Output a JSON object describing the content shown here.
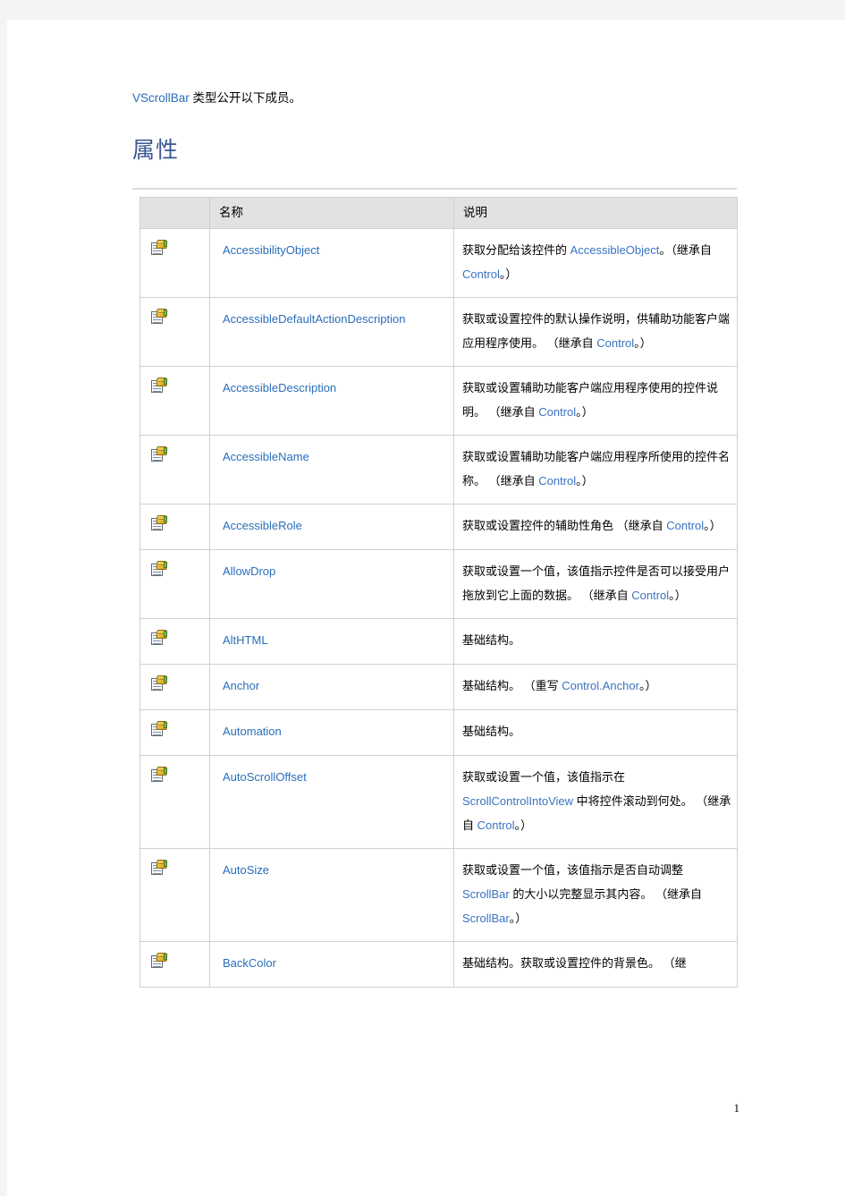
{
  "document": {
    "intro_prefix_link": "VScrollBar",
    "intro_text": " 类型公开以下成员。",
    "section_heading": "属性",
    "page_number": "1"
  },
  "table": {
    "headers": {
      "icon": "",
      "name": "名称",
      "description": "说明"
    },
    "icon_name": "public-property-icon",
    "rows": [
      {
        "name": "AccessibilityObject",
        "desc_parts": [
          {
            "t": "获取分配给该控件的 ",
            "link": false
          },
          {
            "t": "AccessibleObject",
            "link": true
          },
          {
            "t": "。（继承自 ",
            "link": false
          },
          {
            "t": "Control",
            "link": true
          },
          {
            "t": "。）",
            "link": false
          }
        ]
      },
      {
        "name": "AccessibleDefaultActionDescription",
        "desc_parts": [
          {
            "t": "获取或设置控件的默认操作说明，供辅助功能客户端应用程序使用。 （继承自 ",
            "link": false
          },
          {
            "t": "Control",
            "link": true
          },
          {
            "t": "。）",
            "link": false
          }
        ]
      },
      {
        "name": "AccessibleDescription",
        "desc_parts": [
          {
            "t": "获取或设置辅助功能客户端应用程序使用的控件说明。 （继承自 ",
            "link": false
          },
          {
            "t": "Control",
            "link": true
          },
          {
            "t": "。）",
            "link": false
          }
        ]
      },
      {
        "name": "AccessibleName",
        "desc_parts": [
          {
            "t": "获取或设置辅助功能客户端应用程序所使用的控件名称。 （继承自 ",
            "link": false
          },
          {
            "t": "Control",
            "link": true
          },
          {
            "t": "。）",
            "link": false
          }
        ]
      },
      {
        "name": "AccessibleRole",
        "desc_parts": [
          {
            "t": "获取或设置控件的辅助性角色 （继承自 ",
            "link": false
          },
          {
            "t": "Control",
            "link": true
          },
          {
            "t": "。）",
            "link": false
          }
        ]
      },
      {
        "name": "AllowDrop",
        "desc_parts": [
          {
            "t": "获取或设置一个值，该值指示控件是否可以接受用户拖放到它上面的数据。 （继承自 ",
            "link": false
          },
          {
            "t": "Control",
            "link": true
          },
          {
            "t": "。）",
            "link": false
          }
        ]
      },
      {
        "name": "AltHTML",
        "desc_parts": [
          {
            "t": "基础结构。",
            "link": false
          }
        ]
      },
      {
        "name": "Anchor",
        "desc_parts": [
          {
            "t": "基础结构。 （重写 ",
            "link": false
          },
          {
            "t": "Control.Anchor",
            "link": true
          },
          {
            "t": "。）",
            "link": false
          }
        ]
      },
      {
        "name": "Automation",
        "desc_parts": [
          {
            "t": "基础结构。",
            "link": false
          }
        ]
      },
      {
        "name": "AutoScrollOffset",
        "desc_parts": [
          {
            "t": "获取或设置一个值，该值指示在 ",
            "link": false
          },
          {
            "t": "ScrollControlIntoView",
            "link": true
          },
          {
            "t": " 中将控件滚动到何处。 （继承自 ",
            "link": false
          },
          {
            "t": "Control",
            "link": true
          },
          {
            "t": "。）",
            "link": false
          }
        ]
      },
      {
        "name": "AutoSize",
        "desc_parts": [
          {
            "t": "获取或设置一个值，该值指示是否自动调整 ",
            "link": false
          },
          {
            "t": "ScrollBar",
            "link": true
          },
          {
            "t": " 的大小以完整显示其内容。 （继承自 ",
            "link": false
          },
          {
            "t": "ScrollBar",
            "link": true
          },
          {
            "t": "。）",
            "link": false
          }
        ]
      },
      {
        "name": "BackColor",
        "desc_parts": [
          {
            "t": "基础结构。获取或设置控件的背景色。 （继",
            "link": false
          }
        ]
      }
    ]
  },
  "colors": {
    "link": "#2a6ebb",
    "heading": "#3a5694",
    "table_header_bg": "#e2e2e2",
    "table_border": "#d0d0d0",
    "page_bg": "#f4f4f4"
  }
}
